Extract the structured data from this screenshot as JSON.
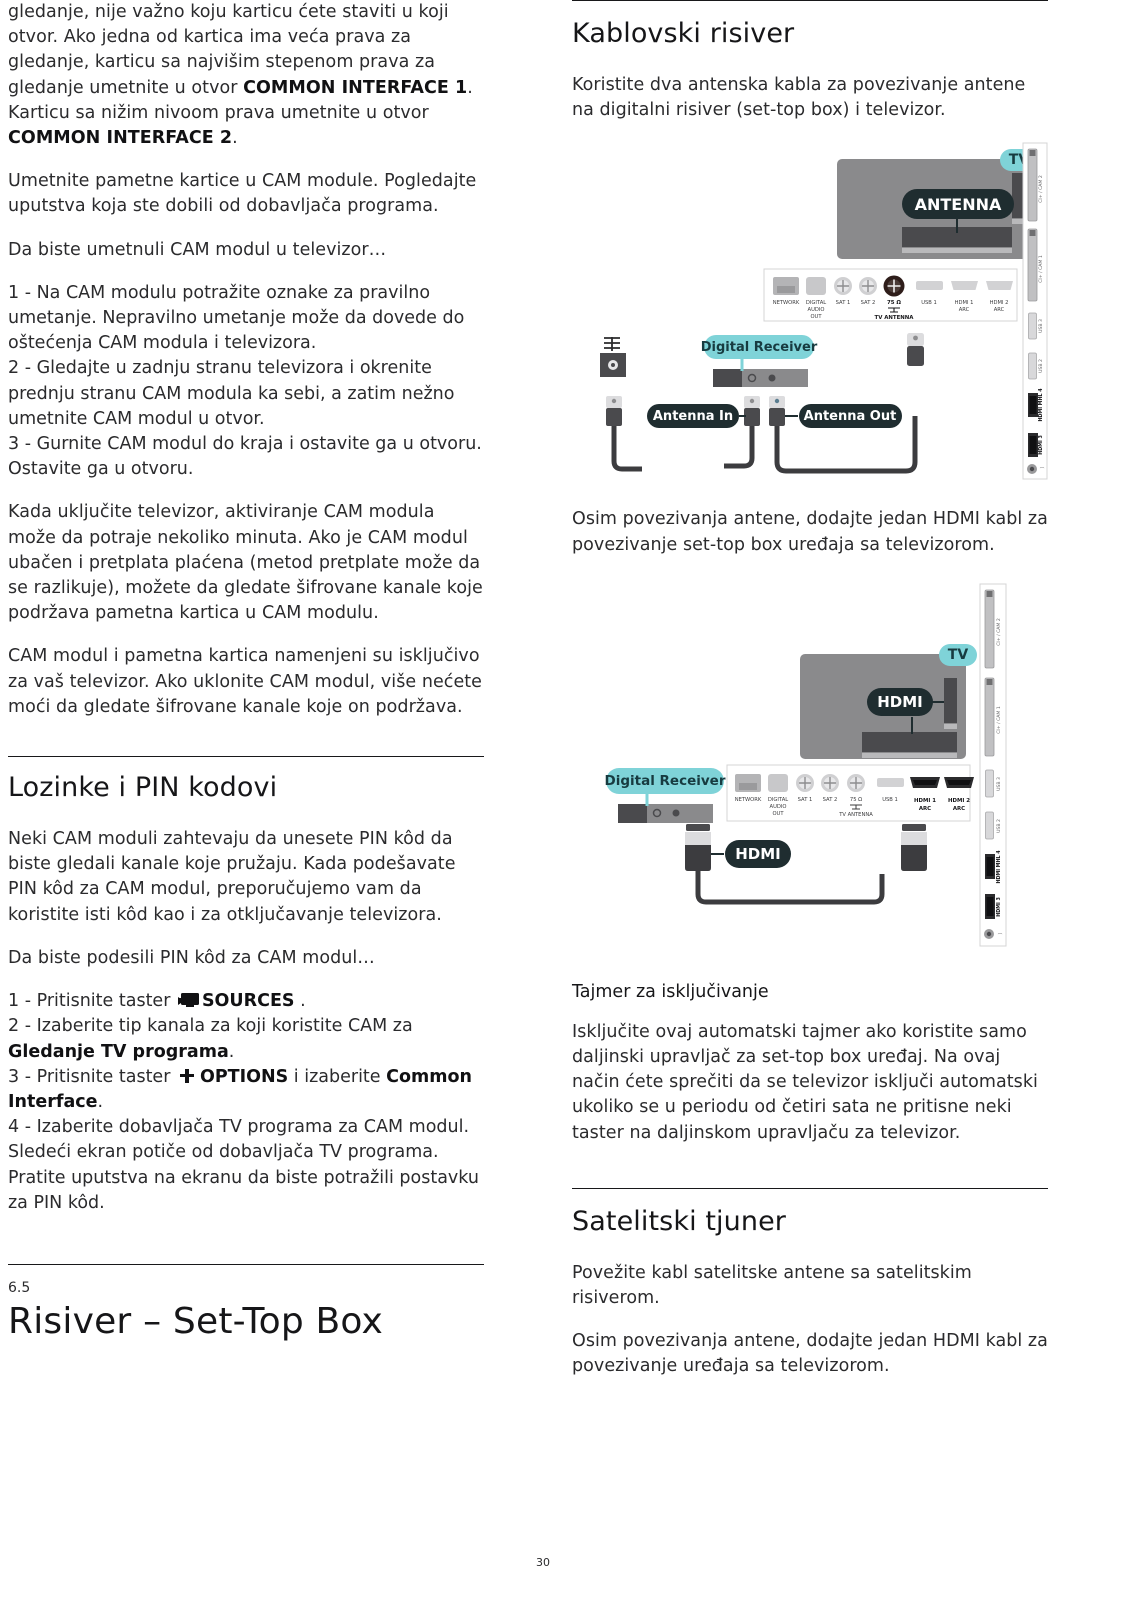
{
  "page": {
    "number": "30"
  },
  "left_column": {
    "para_1": {
      "seg1": "gledanje, nije važno koju karticu ćete staviti u koji otvor. Ako jedna od kartica ima veća prava za gledanje, karticu sa najvišim stepenom prava za gledanje umetnite u otvor ",
      "bold1": "COMMON INTERFACE 1",
      "seg2": ". Karticu sa nižim nivoom prava umetnite u otvor ",
      "bold2": "COMMON INTERFACE 2",
      "seg3": "."
    },
    "para_2": "Umetnite pametne kartice u CAM module. Pogledajte uputstva koja ste dobili od dobavljača programa.",
    "para_3": "Da biste umetnuli CAM modul u televizor…",
    "steps_cam": [
      "1 -  Na CAM modulu potražite oznake za pravilno umetanje. Nepravilno umetanje može da dovede do oštećenja CAM modula i televizora.",
      "2 -  Gledajte u zadnju stranu televizora i okrenite prednju stranu CAM modula ka sebi, a zatim nežno umetnite CAM modul u otvor.",
      "3 -  Gurnite CAM modul do kraja i ostavite ga u otvoru. Ostavite ga u otvoru."
    ],
    "para_4": "Kada uključite televizor, aktiviranje CAM modula može da potraje nekoliko minuta. Ako je CAM modul ubačen i pretplata plaćena (metod pretplate može da se razlikuje), možete da gledate šifrovane kanale koje podržava pametna kartica u CAM modulu.",
    "para_5": "CAM modul i pametna kartica namenjeni su isključivo za vaš televizor. Ako uklonite CAM modul, više nećete moći da gledate šifrovane kanale koje on podržava.",
    "section_passwords": {
      "title": "Lozinke i PIN kodovi",
      "para_1": "Neki CAM moduli zahtevaju da unesete PIN kôd da biste gledali kanale koje pružaju. Kada podešavate PIN kôd za CAM modul, preporučujemo vam da koristite isti kôd kao i za otključavanje televizora.",
      "para_2": "Da biste podesili PIN kôd za CAM modul…",
      "step1_pre": "1 -  Pritisnite taster ",
      "step1_icon": "sources-icon",
      "step1_bold": "SOURCES",
      "step1_post": " .",
      "step2_pre": "2 -  Izaberite tip kanala za koji koristite CAM za ",
      "step2_bold": "Gledanje TV programa",
      "step2_post": ".",
      "step3_pre": "3 -  Pritisnite taster ",
      "step3_icon": "plus-icon",
      "step3_bold1": "OPTIONS",
      "step3_mid": " i izaberite ",
      "step3_bold2": "Common Interface",
      "step3_post": ".",
      "step4": "4 -  Izaberite dobavljača TV programa za CAM modul. Sledeći ekran potiče od dobavljača TV programa. Pratite uputstva na ekranu da biste potražili postavku za PIN kôd."
    },
    "chapter": {
      "number": "6.5",
      "title": "Risiver – Set-Top Box"
    }
  },
  "right_column": {
    "section_cable": {
      "title": "Kablovski risiver",
      "para_1": "Koristite dva antenska kabla za povezivanje antene na digitalni risiver (set-top box) i televizor.",
      "para_2": "Osim povezivanja antene, dodajte jedan HDMI kabl za povezivanje set-top box uređaja sa televizorom."
    },
    "section_timer": {
      "title": "Tajmer za isključivanje",
      "para_1": "Isključite ovaj automatski tajmer ako koristite samo daljinski upravljač za set-top box uređaj. Na ovaj način ćete sprečiti da se televizor isključi automatski ukoliko se u periodu od četiri sata ne pritisne neki taster na daljinskom upravljaču za televizor."
    },
    "section_satellite": {
      "title": "Satelitski tjuner",
      "para_1": "Povežite kabl satelitske antene sa satelitskim risiverom.",
      "para_2": "Osim povezivanja antene, dodajte jedan HDMI kabl za povezivanje uređaja sa televizorom."
    }
  },
  "diagram_antenna": {
    "name": "antenna-connection-diagram",
    "tv_badge": "TV",
    "tv_callout": "ANTENNA",
    "device_callout": "Digital Receiver",
    "antenna_in": "Antenna In",
    "antenna_out": "Antenna Out",
    "back_panel_ports": [
      {
        "label": "NETWORK",
        "type": "rj45"
      },
      {
        "label": "DIGITAL AUDIO OUT",
        "type": "optical"
      },
      {
        "label": "SAT 1",
        "type": "coax"
      },
      {
        "label": "SAT 2",
        "type": "coax"
      },
      {
        "label": "75 Ω",
        "sublabel": "TV ANTENNA",
        "type": "coax-hl"
      },
      {
        "label": "USB 1",
        "type": "usb"
      },
      {
        "label": "HDMI 1 ARC",
        "type": "hdmi"
      },
      {
        "label": "HDMI 2 ARC",
        "type": "hdmi"
      }
    ],
    "side_panel_ports": [
      {
        "label": "CI+ / CAM 2",
        "type": "ci"
      },
      {
        "label": "CI+ / CAM 1",
        "type": "ci"
      },
      {
        "label": "USB 3",
        "type": "usb"
      },
      {
        "label": "USB 2",
        "type": "usb"
      },
      {
        "label": "HDMI MHL 4",
        "type": "hdmi"
      },
      {
        "label": "HDMI 3",
        "type": "hdmi"
      },
      {
        "label": "headphone",
        "type": "jack"
      }
    ]
  },
  "diagram_hdmi": {
    "name": "hdmi-connection-diagram",
    "tv_badge": "TV",
    "tv_callout": "HDMI",
    "device_callout": "Digital Receiver",
    "cable_callout": "HDMI",
    "back_panel_ports": [
      {
        "label": "NETWORK",
        "type": "rj45"
      },
      {
        "label": "DIGITAL AUDIO OUT",
        "type": "optical"
      },
      {
        "label": "SAT 1",
        "type": "coax"
      },
      {
        "label": "SAT 2",
        "type": "coax"
      },
      {
        "label": "75 Ω",
        "sublabel": "TV ANTENNA",
        "type": "coax"
      },
      {
        "label": "USB 1",
        "type": "usb"
      },
      {
        "label": "HDMI 1 ARC",
        "type": "hdmi-hl"
      },
      {
        "label": "HDMI 2 ARC",
        "type": "hdmi-hl"
      }
    ],
    "side_panel_ports": [
      {
        "label": "CI+ / CAM 2",
        "type": "ci"
      },
      {
        "label": "CI+ / CAM 1",
        "type": "ci"
      },
      {
        "label": "USB 3",
        "type": "usb"
      },
      {
        "label": "USB 2",
        "type": "usb"
      },
      {
        "label": "HDMI MHL 4",
        "type": "hdmi"
      },
      {
        "label": "HDMI 3",
        "type": "hdmi"
      },
      {
        "label": "headphone",
        "type": "jack"
      }
    ]
  },
  "colors": {
    "accent_teal": "#7fd3d8",
    "callout_dark": "#1f2d30",
    "tv_body": "#8a8a8c",
    "text": "#2b2b2d"
  }
}
